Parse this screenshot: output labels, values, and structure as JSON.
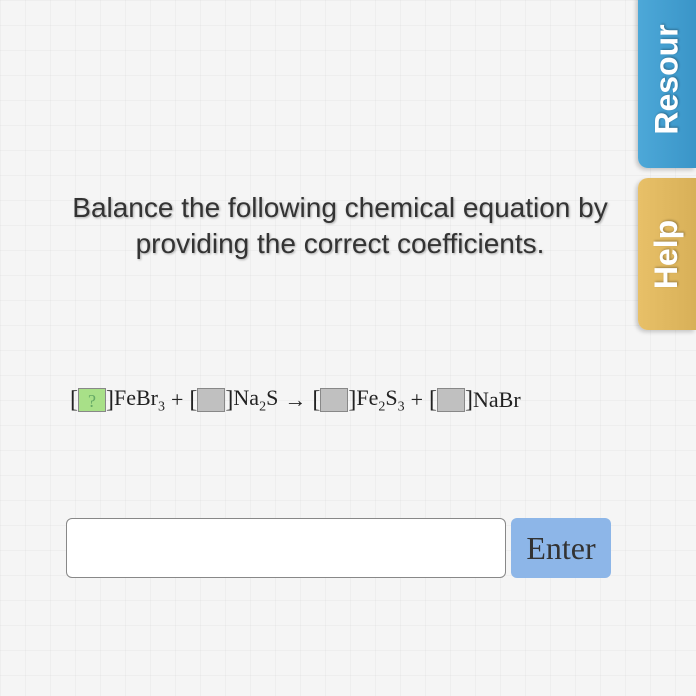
{
  "prompt": "Balance the following chemical equation by providing the correct coefficients.",
  "equation": {
    "coef1_placeholder": "?",
    "term1_elem": "FeBr",
    "term1_sub": "3",
    "plus1": "+",
    "term2_elem_a": "Na",
    "term2_sub_a": "2",
    "term2_elem_b": "S",
    "arrow": "→",
    "term3_elem_a": "Fe",
    "term3_sub_a": "2",
    "term3_elem_b": "S",
    "term3_sub_b": "3",
    "plus2": "+",
    "term4_elem": "NaBr"
  },
  "input": {
    "value": "",
    "placeholder": ""
  },
  "buttons": {
    "enter": "Enter"
  },
  "sidetabs": {
    "resources": "Resour",
    "help": "Help"
  }
}
